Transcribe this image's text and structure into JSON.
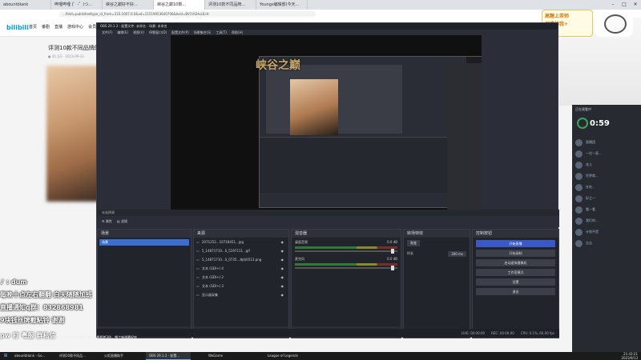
{
  "browser": {
    "tabs": [
      "abountblank",
      "哔哩哔哩 (゜-゜)つ...",
      "峡谷之巅好不好...",
      "峡谷之巅10数...",
      "评测10款不同品牌...",
      "Youngs编辑部(今天..."
    ],
    "url": "…field=publishedtype_id_from=333.1007.0.0&vd=11519053640706&bvid=BV1VGHvLEcH"
  },
  "bilibili": {
    "logo": "bilibili",
    "nav": [
      "首页",
      "番剧",
      "直播",
      "游戏中心",
      "会员购",
      "漫画"
    ],
    "article_title": "评测10款不同品牌的",
    "article_meta": "● 41.3万 · 2023-09-13"
  },
  "banner": {
    "line1": "高糖上茶师",
    "line2": "深情的我+"
  },
  "obs": {
    "title": "OBS 29.1.3 - 配置文件: 未命名 - 场景: 未命名",
    "menu": [
      "文件(F)",
      "编辑(E)",
      "视图(V)",
      "停靠窗口(D)",
      "配置文件(P)",
      "场景集合(S)",
      "工具(T)",
      "帮助(H)"
    ],
    "overlay_text": "峡谷之巅",
    "overlay_tiktok": "♪ dum",
    "preview_status": "未选择源",
    "scene_bar": {
      "properties": "⚙ 属性",
      "filters": "▤ 滤镜"
    },
    "scenes": {
      "header": "场景",
      "items": [
        "场景"
      ]
    },
    "sources": {
      "header": "来源",
      "items": [
        "2071252...10718451...jpg",
        "5_14871710...S_5197111...gif",
        "5_14871710...S_0735...淘抖6513.png",
        "文本 (GDI+) 4",
        "文本 (GDI+) 2",
        "文本 (GDI+) 3",
        "显示器采集"
      ]
    },
    "mixer": {
      "header": "混音器",
      "channels": [
        {
          "name": "桌面音频",
          "db": "0.0 dB"
        },
        {
          "name": "麦克风",
          "db": "0.0 dB"
        }
      ]
    },
    "transitions": {
      "header": "转场特效",
      "type": "渐变",
      "duration_label": "时长",
      "duration": "300 ms"
    },
    "controls": {
      "header": "控制按钮",
      "start_stream": "开始直播",
      "start_record": "开始录制",
      "virtual_cam": "启动虚拟摄像机",
      "studio_mode": "工作室模式",
      "settings": "设置",
      "exit": "退出"
    },
    "status": {
      "live": "LIVE: 00:00:00",
      "rec": "REC: 00:00:00",
      "cpu": "CPU: 0.1%, 60.00 fps"
    }
  },
  "chat": {
    "header": "正在观看中",
    "timer": "0:59",
    "users": [
      "直播团",
      "一往一直...",
      "花儿",
      "世界就...",
      "在吃..",
      "好之一",
      "看一看",
      "我们的...",
      "计划不是",
      "吉吉"
    ]
  },
  "overlay": {
    "tiktok": "♪ : dum",
    "line1": "每晚十点左右翻翻 白天随随加班",
    "line2": "直播通知q群：832868981",
    "line3": "9块钱丝牌截粘铃 谢谢",
    "bottom": "pw 打 粤服 群私信",
    "sub": "0款不同品牌的大狗蛋，最亮价格相差3倍，哪个味道最好吃"
  },
  "taskbar": {
    "items": [
      "abountblank - Go...",
      "评测10款不同品...",
      "火炬直播助手",
      "OBS 29.1.3 - 配置...",
      "",
      "WeGame",
      "",
      "League of Legends"
    ],
    "time": "21:43:21",
    "date": "2023/9/13"
  }
}
